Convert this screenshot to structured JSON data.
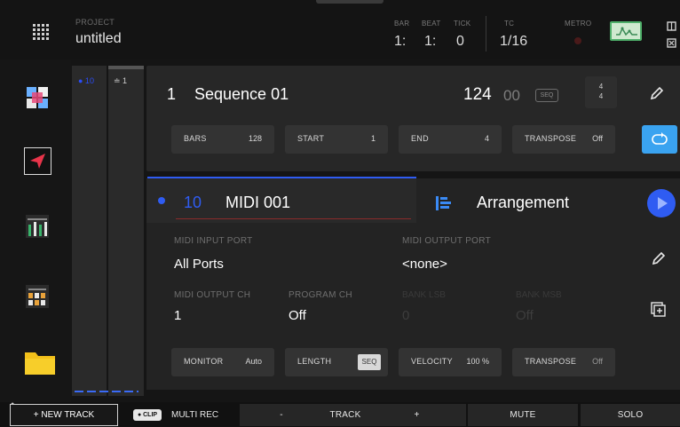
{
  "topbar": {
    "grid_icon": "grid-icon",
    "project_label": "PROJECT",
    "project_name": "untitled",
    "bar_label": "BAR",
    "bar_value": "1:",
    "beat_label": "BEAT",
    "beat_value": "1:",
    "tick_label": "TICK",
    "tick_value": "0",
    "tc_label": "TC",
    "tc_value": "1/16",
    "metro_label": "METRO",
    "metro_status_color": "#4a1a1a",
    "waveform_icon": "waveform-icon",
    "right_icons": [
      "window-icon",
      "close-icon"
    ]
  },
  "sidebar": {
    "items": [
      {
        "icon": "pads-icon",
        "color": "#6ab0ff"
      },
      {
        "icon": "cursor-icon",
        "color": "#e8344a"
      },
      {
        "icon": "mixer-icon",
        "color": "#38b36a"
      },
      {
        "icon": "grid-mixer-icon",
        "color": "#e8a23a"
      },
      {
        "icon": "folder-icon",
        "color": "#f2c01a"
      }
    ]
  },
  "track_column": {
    "col1_label": "● 10",
    "col2_label": "≐ 1"
  },
  "sequence": {
    "number": "1",
    "name": "Sequence 01",
    "bpm": "124",
    "bpm_fraction": "00",
    "seq_tag": "SEQ",
    "time_sig_top": "4",
    "time_sig_bottom": "4",
    "params": [
      {
        "label": "BARS",
        "value": "128"
      },
      {
        "label": "START",
        "value": "1"
      },
      {
        "label": "END",
        "value": "4"
      },
      {
        "label": "TRANSPOSE",
        "value": "Off"
      }
    ]
  },
  "track": {
    "number": "10",
    "name": "MIDI 001",
    "arrangement_label": "Arrangement",
    "fields": {
      "midi_input_port_label": "MIDI INPUT PORT",
      "midi_input_port_value": "All Ports",
      "midi_output_port_label": "MIDI OUTPUT PORT",
      "midi_output_port_value": "<none>",
      "midi_output_ch_label": "MIDI OUTPUT CH",
      "midi_output_ch_value": "1",
      "program_ch_label": "PROGRAM CH",
      "program_ch_value": "Off",
      "bank_lsb_label": "BANK LSB",
      "bank_lsb_value": "0",
      "bank_msb_label": "BANK MSB",
      "bank_msb_value": "Off"
    },
    "params": [
      {
        "label": "MONITOR",
        "value": "Auto"
      },
      {
        "label": "LENGTH",
        "value": "SEQ"
      },
      {
        "label": "VELOCITY",
        "value": "100 %"
      },
      {
        "label": "TRANSPOSE",
        "value": "Off"
      }
    ]
  },
  "bottombar": {
    "new_track": "+ NEW TRACK",
    "clip_chip": "● CLIP",
    "multi_rec": "MULTI REC",
    "minus": "-",
    "track": "TRACK",
    "plus": "+",
    "mute": "MUTE",
    "solo": "SOLO"
  }
}
